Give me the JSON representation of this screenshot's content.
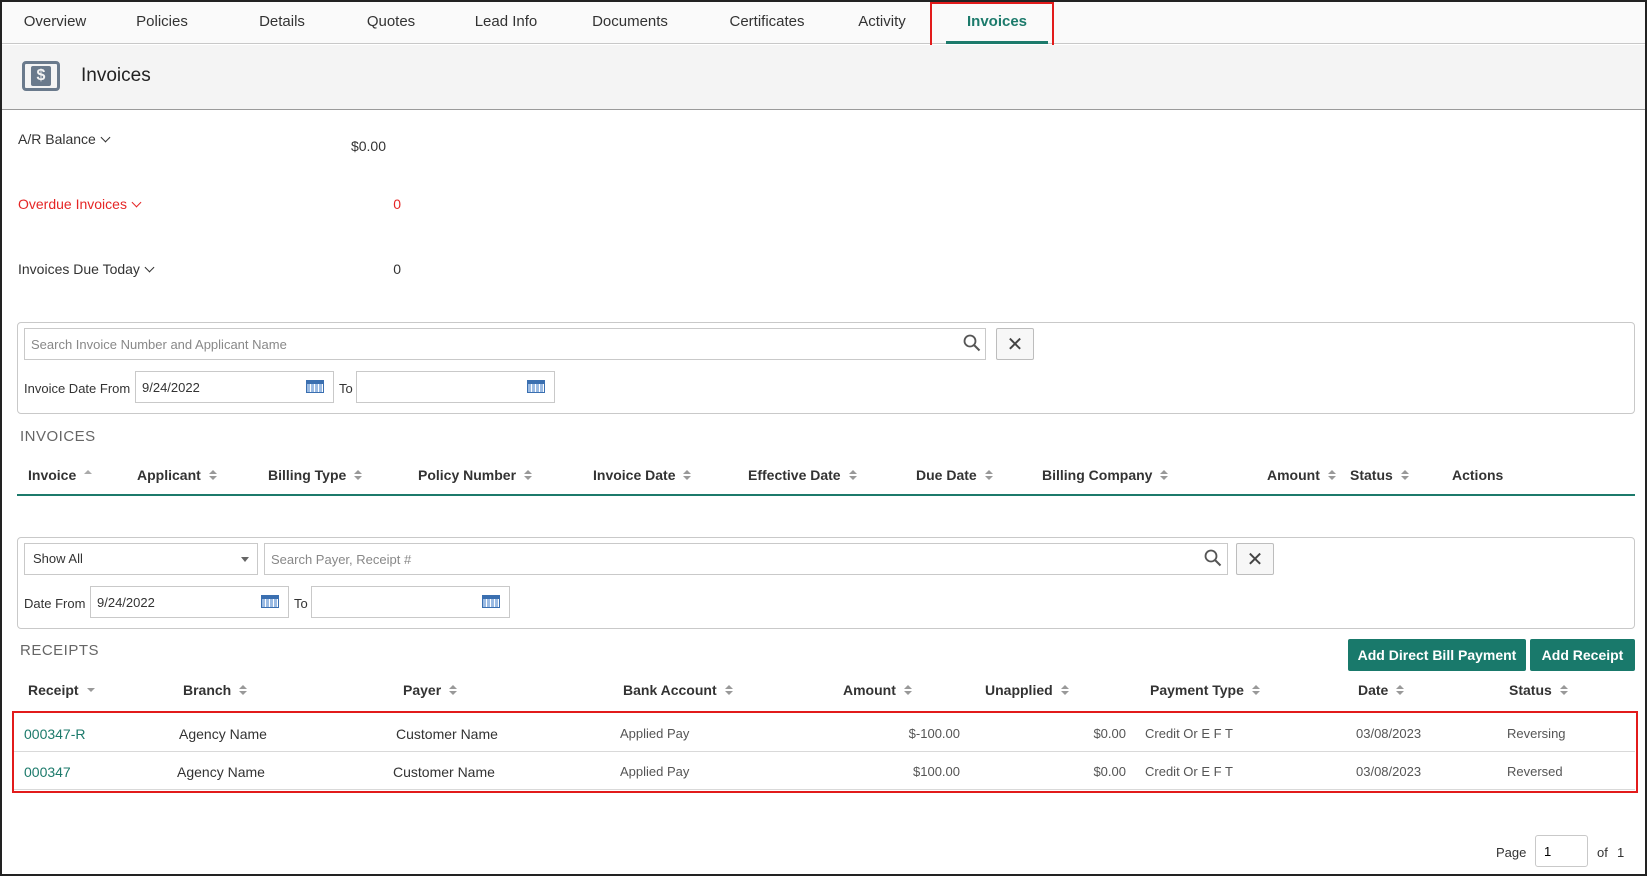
{
  "tabs": [
    {
      "label": "Overview"
    },
    {
      "label": "Policies"
    },
    {
      "label": "Details"
    },
    {
      "label": "Quotes"
    },
    {
      "label": "Lead Info"
    },
    {
      "label": "Documents"
    },
    {
      "label": "Certificates"
    },
    {
      "label": "Activity"
    },
    {
      "label": "Invoices",
      "active": true
    }
  ],
  "header": {
    "title": "Invoices",
    "icon": "dollar-icon"
  },
  "summary": {
    "ar_balance_label": "A/R Balance",
    "ar_balance_value": "$0.00",
    "overdue_label": "Overdue Invoices",
    "overdue_value": "0",
    "due_today_label": "Invoices Due Today",
    "due_today_value": "0"
  },
  "invoice_filter": {
    "search_placeholder": "Search Invoice Number and Applicant Name",
    "date_from_label": "Invoice Date From",
    "date_from_value": "9/24/2022",
    "to_label": "To",
    "date_to_value": ""
  },
  "invoices": {
    "section_title": "INVOICES",
    "columns": [
      "Invoice",
      "Applicant",
      "Billing Type",
      "Policy Number",
      "Invoice Date",
      "Effective Date",
      "Due Date",
      "Billing Company",
      "Amount",
      "Status",
      "Actions"
    ]
  },
  "receipt_filter": {
    "select_value": "Show All",
    "search_placeholder": "Search Payer, Receipt #",
    "date_from_label": "Date From",
    "date_from_value": "9/24/2022",
    "to_label": "To",
    "date_to_value": ""
  },
  "receipts": {
    "section_title": "RECEIPTS",
    "add_direct_bill_label": "Add Direct Bill Payment",
    "add_receipt_label": "Add Receipt",
    "columns": [
      "Receipt",
      "Branch",
      "Payer",
      "Bank Account",
      "Amount",
      "Unapplied",
      "Payment Type",
      "Date",
      "Status"
    ],
    "rows": [
      {
        "receipt": "000347-R",
        "branch": "Agency Name",
        "payer": "Customer Name",
        "bank_account": "Applied Pay",
        "amount": "$-100.00",
        "unapplied": "$0.00",
        "payment_type": "Credit Or E F T",
        "date": "03/08/2023",
        "status": "Reversing"
      },
      {
        "receipt": "000347",
        "branch": "Agency Name",
        "payer": "Customer Name",
        "bank_account": "Applied Pay",
        "amount": "$100.00",
        "unapplied": "$0.00",
        "payment_type": "Credit Or E F T",
        "date": "03/08/2023",
        "status": "Reversed"
      }
    ]
  },
  "pager": {
    "page_label": "Page",
    "page_value": "1",
    "of_label": "of",
    "total_pages": "1"
  },
  "colors": {
    "accent": "#19796b",
    "alert": "#e52626",
    "highlight": "#e21b1b"
  }
}
